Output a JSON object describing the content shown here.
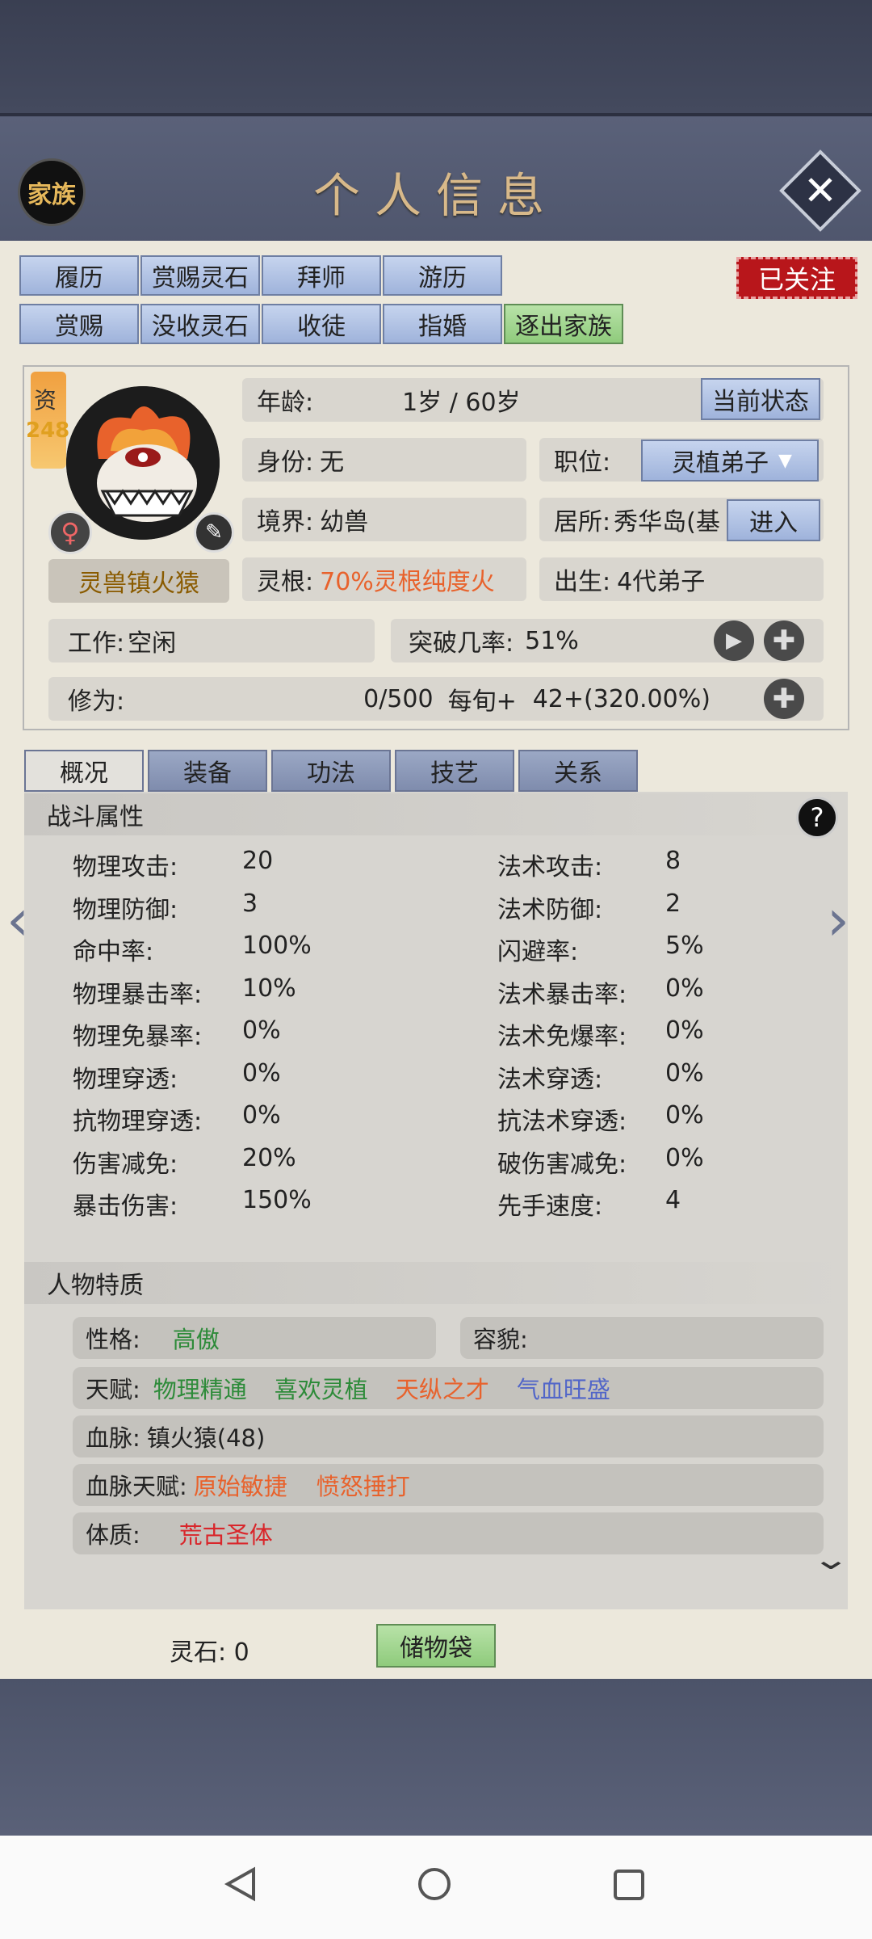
{
  "header": {
    "title": "个人信息",
    "family_label": "家族"
  },
  "actions_row1": [
    "履历",
    "赏赐灵石",
    "拜师",
    "游历"
  ],
  "actions_row2": [
    "赏赐",
    "没收灵石",
    "收徒",
    "指婚",
    "逐出家族"
  ],
  "follow_label": "已关注",
  "profile": {
    "aptitude_label": "资",
    "aptitude_value": "248",
    "gender_symbol": "♀",
    "name": "灵兽镇火猿",
    "age_label": "年龄:",
    "age_value": "1岁 / 60岁",
    "current_state_label": "当前状态",
    "identity_label": "身份:",
    "identity_value": "无",
    "position_label": "职位:",
    "position_value": "灵植弟子",
    "realm_label": "境界:",
    "realm_value": "幼兽",
    "residence_label": "居所:",
    "residence_value": "秀华岛(基",
    "enter_label": "进入",
    "root_label": "灵根:",
    "root_value": "70%灵根纯度火",
    "birth_label": "出生:",
    "birth_value": "4代弟子",
    "work_label": "工作:",
    "work_value": "空闲",
    "breakthrough_label": "突破几率:",
    "breakthrough_value": "51%",
    "cultivation_label": "修为:",
    "cultivation_value": "0/500",
    "per_period_label": "每旬+",
    "per_period_value": "42+(320.00%)"
  },
  "tabs": [
    "概况",
    "装备",
    "功法",
    "技艺",
    "关系"
  ],
  "battle": {
    "title": "战斗属性",
    "help": "?",
    "left": [
      {
        "label": "物理攻击:",
        "value": "20"
      },
      {
        "label": "物理防御:",
        "value": "3"
      },
      {
        "label": "命中率:",
        "value": "100%"
      },
      {
        "label": "物理暴击率:",
        "value": "10%"
      },
      {
        "label": "物理免暴率:",
        "value": "0%"
      },
      {
        "label": "物理穿透:",
        "value": "0%"
      },
      {
        "label": "抗物理穿透:",
        "value": "0%"
      },
      {
        "label": "伤害减免:",
        "value": "20%"
      },
      {
        "label": "暴击伤害:",
        "value": "150%"
      }
    ],
    "right": [
      {
        "label": "法术攻击:",
        "value": "8"
      },
      {
        "label": "法术防御:",
        "value": "2"
      },
      {
        "label": "闪避率:",
        "value": "5%"
      },
      {
        "label": "法术暴击率:",
        "value": "0%"
      },
      {
        "label": "法术免爆率:",
        "value": "0%"
      },
      {
        "label": "法术穿透:",
        "value": "0%"
      },
      {
        "label": "抗法术穿透:",
        "value": "0%"
      },
      {
        "label": "破伤害减免:",
        "value": "0%"
      },
      {
        "label": "先手速度:",
        "value": "4"
      }
    ]
  },
  "traits": {
    "title": "人物特质",
    "personality_label": "性格:",
    "personality_value": "高傲",
    "appearance_label": "容貌:",
    "talent_label": "天赋:",
    "talents": [
      "物理精通",
      "喜欢灵植",
      "天纵之才",
      "气血旺盛"
    ],
    "talent_colors": [
      "#2e8b3a",
      "#2e8b3a",
      "#e8622c",
      "#5266c8"
    ],
    "bloodline_label": "血脉:",
    "bloodline_value": "镇火猿(48)",
    "bloodline_talent_label": "血脉天赋:",
    "bloodline_talents": [
      "原始敏捷",
      "愤怒捶打"
    ],
    "physique_label": "体质:",
    "physique_value": "荒古圣体"
  },
  "footer": {
    "stones_label": "灵石:",
    "stones_value": "0",
    "bag_label": "储物袋"
  },
  "colors": {
    "root_value": "#e8622c",
    "physique": "#d9262b",
    "bloodline_talent": "#e8622c"
  }
}
